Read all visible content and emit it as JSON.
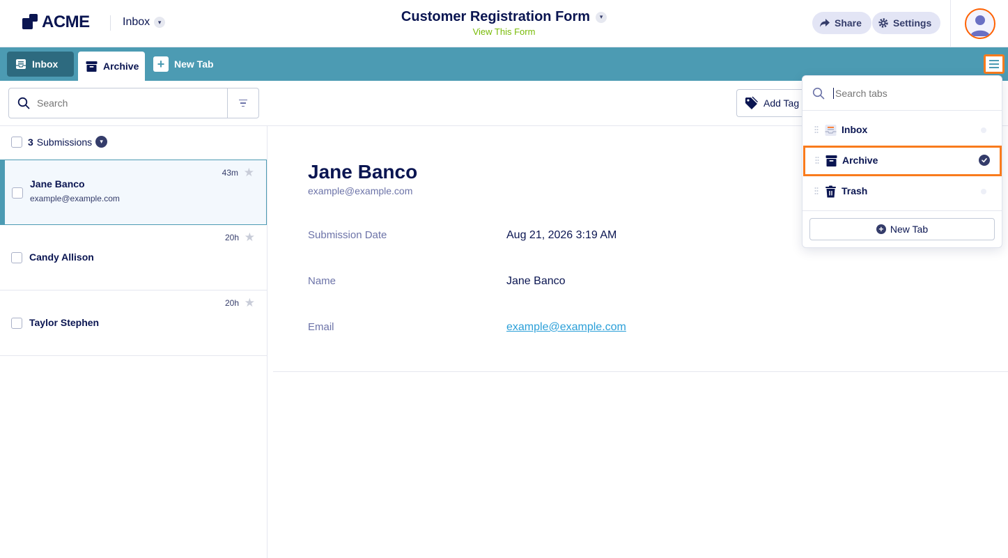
{
  "app": {
    "logo_text": "ACME",
    "header_inbox_label": "Inbox",
    "form_title": "Customer Registration Form",
    "form_subtitle": "View This Form",
    "share_label": "Share",
    "settings_label": "Settings"
  },
  "tabs": [
    {
      "label": "Inbox",
      "icon": "inbox-icon",
      "state": "inactive"
    },
    {
      "label": "Archive",
      "icon": "archive-icon",
      "state": "active"
    },
    {
      "label": "New Tab",
      "icon": "plus-icon",
      "state": "action"
    }
  ],
  "toolbar": {
    "search_placeholder": "Search",
    "add_tag_label": "Add Tag"
  },
  "list": {
    "count": "3",
    "count_label": "Submissions",
    "items": [
      {
        "name": "Jane Banco",
        "email": "example@example.com",
        "time": "43m",
        "selected": true
      },
      {
        "name": "Candy Allison",
        "email": "",
        "time": "20h",
        "selected": false
      },
      {
        "name": "Taylor Stephen",
        "email": "",
        "time": "20h",
        "selected": false
      }
    ]
  },
  "detail": {
    "name": "Jane Banco",
    "email": "example@example.com",
    "fields": [
      {
        "label": "Submission Date",
        "value": "Aug 21, 2026 3:19 AM",
        "link": false
      },
      {
        "label": "Name",
        "value": "Jane Banco",
        "link": false
      },
      {
        "label": "Email",
        "value": "example@example.com",
        "link": true
      }
    ]
  },
  "tab_menu": {
    "search_placeholder": "Search tabs",
    "items": [
      {
        "label": "Inbox",
        "icon": "inbox-icon",
        "selected": false
      },
      {
        "label": "Archive",
        "icon": "archive-icon",
        "selected": true
      },
      {
        "label": "Trash",
        "icon": "trash-icon",
        "selected": false
      }
    ],
    "new_tab_label": "New Tab"
  },
  "colors": {
    "brand_navy": "#0a1551",
    "tabbar_teal": "#4c9bb3",
    "highlight_orange": "#f97b1c",
    "link_blue": "#2a9fd8",
    "subtitle_green": "#78bb07"
  }
}
